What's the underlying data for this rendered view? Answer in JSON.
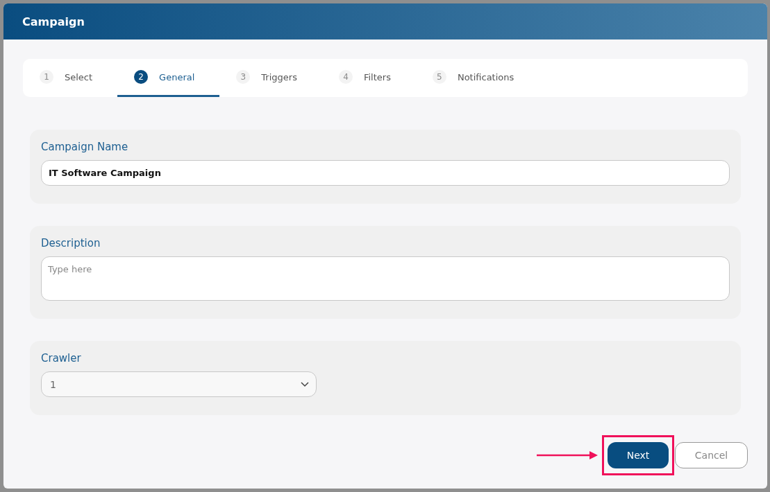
{
  "window": {
    "title": "Campaign"
  },
  "steps": [
    {
      "number": "1",
      "label": "Select",
      "selected": false
    },
    {
      "number": "2",
      "label": "General",
      "selected": true
    },
    {
      "number": "3",
      "label": "Triggers",
      "selected": false
    },
    {
      "number": "4",
      "label": "Filters",
      "selected": false
    },
    {
      "number": "5",
      "label": "Notifications",
      "selected": false
    }
  ],
  "fields": [
    {
      "kind": "text",
      "label": "Campaign Name",
      "value": "IT Software Campaign"
    },
    {
      "kind": "textarea",
      "label": "Description",
      "placeholder": "Type here"
    },
    {
      "kind": "select",
      "label": "Crawler",
      "value": "1"
    }
  ],
  "buttons": {
    "next": "Next",
    "cancel": "Cancel"
  }
}
